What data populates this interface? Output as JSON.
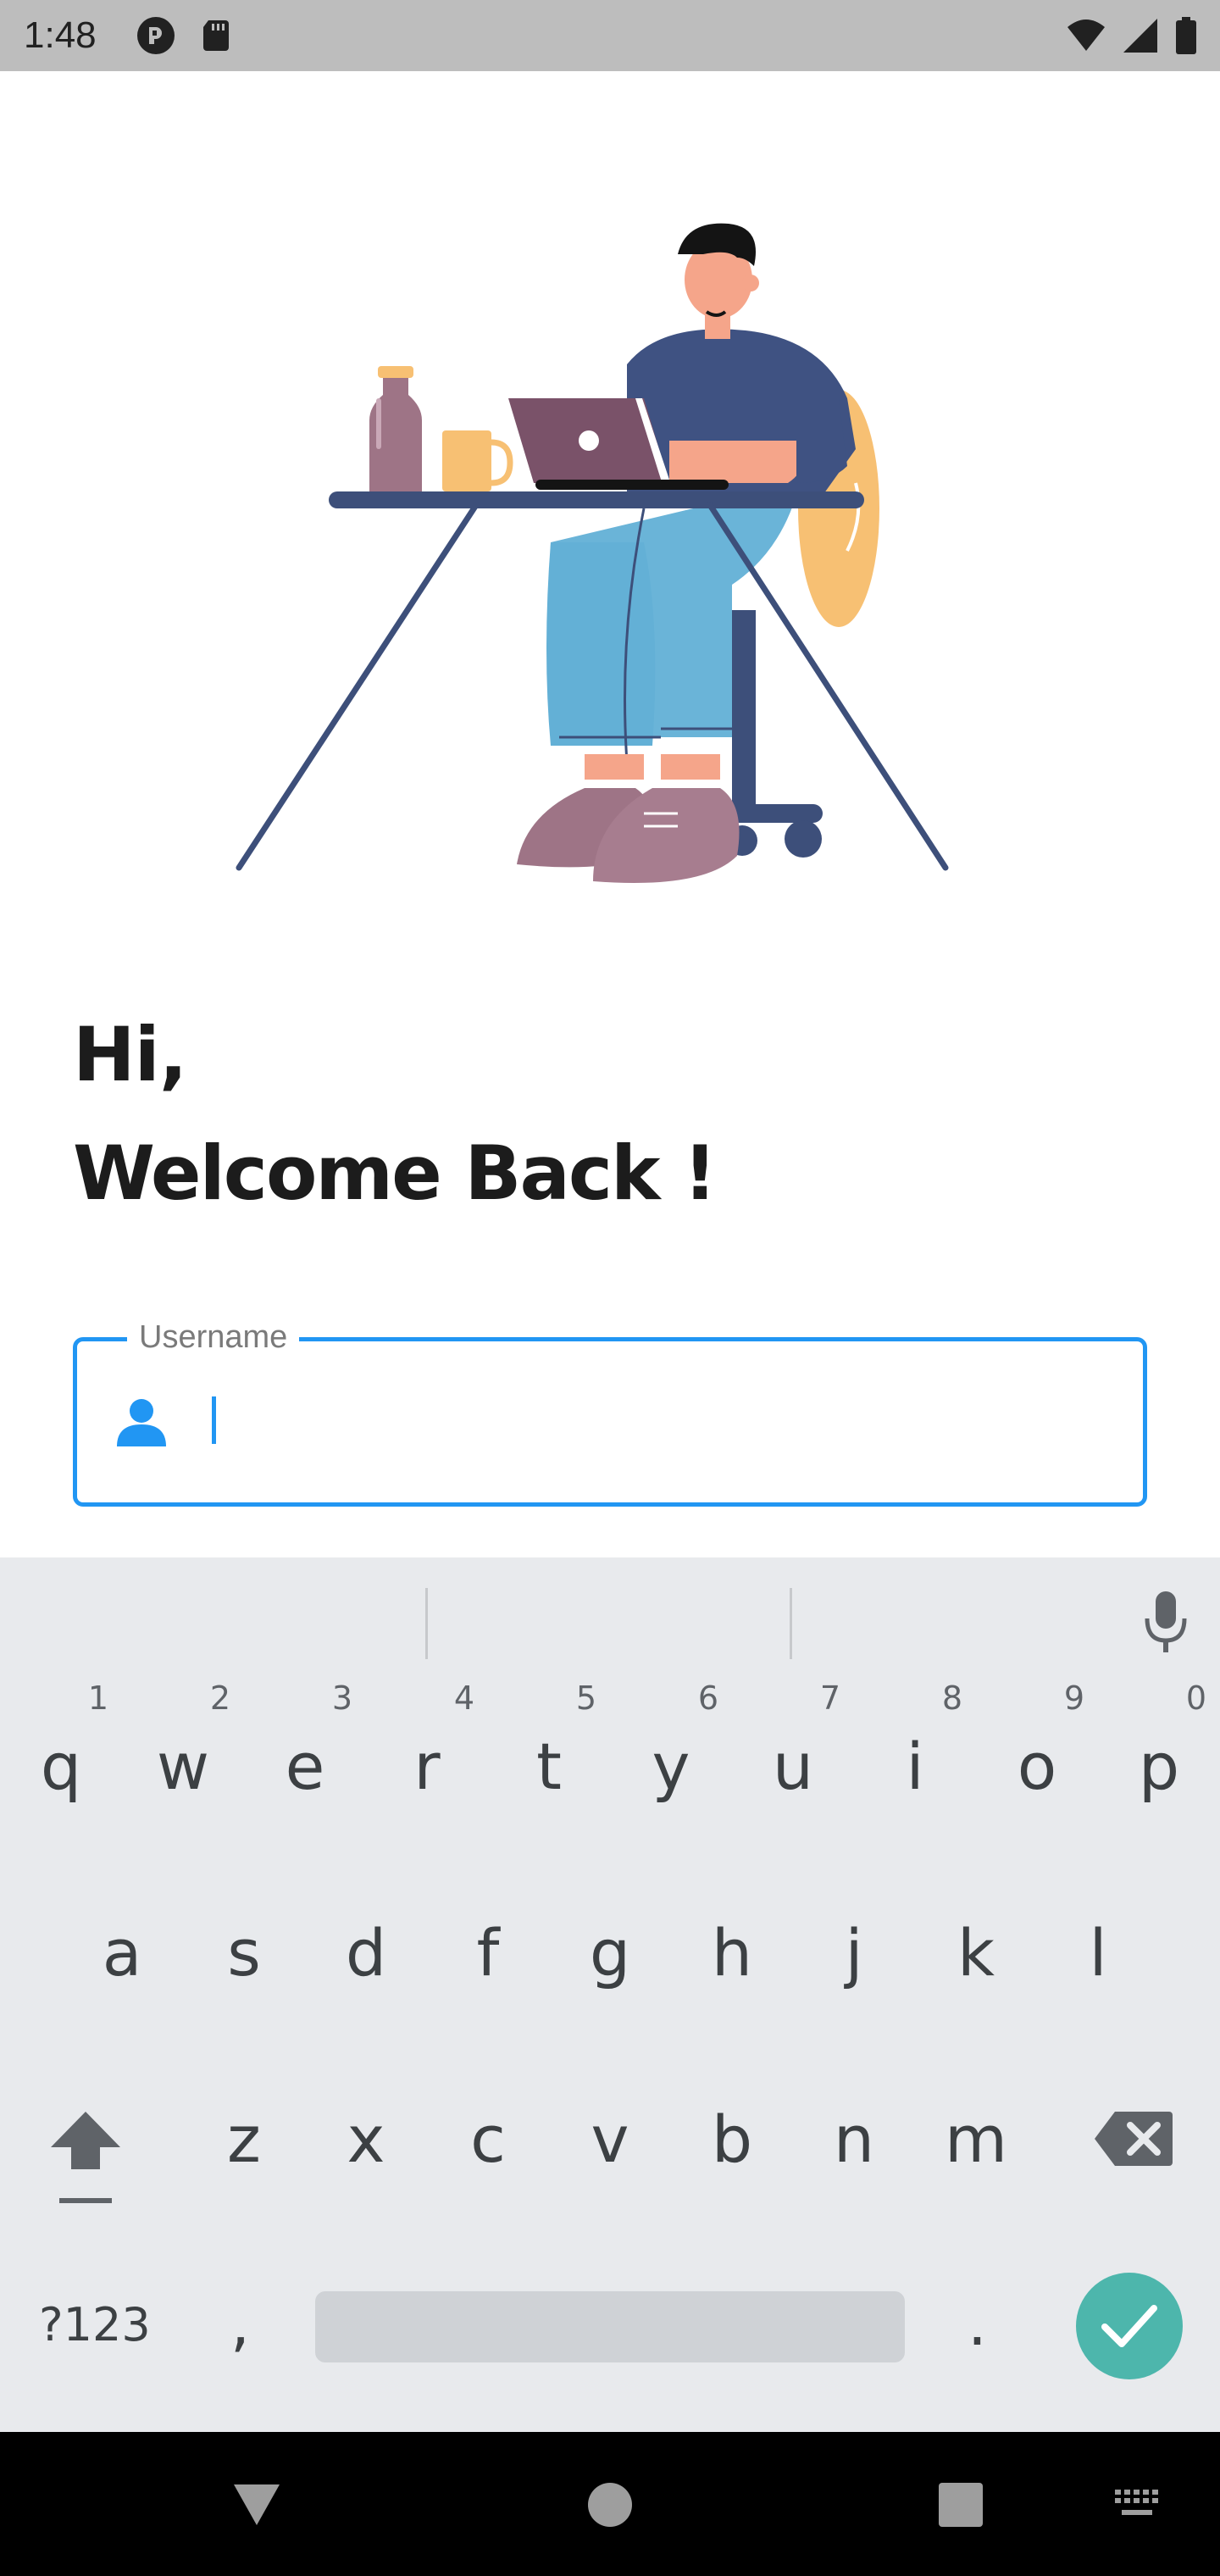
{
  "status_bar": {
    "time": "1:48",
    "left_icons": [
      "privacy-indicator-icon",
      "sd-card-icon"
    ],
    "right_icons": [
      "wifi-icon",
      "cell-signal-icon",
      "battery-icon"
    ]
  },
  "greeting": {
    "line1": "Hi,",
    "line2": "Welcome Back !"
  },
  "username_field": {
    "label": "Username",
    "value": "",
    "icon": "person-icon",
    "accent_color": "#2196f3"
  },
  "keyboard": {
    "row1": [
      {
        "key": "q",
        "hint": "1"
      },
      {
        "key": "w",
        "hint": "2"
      },
      {
        "key": "e",
        "hint": "3"
      },
      {
        "key": "r",
        "hint": "4"
      },
      {
        "key": "t",
        "hint": "5"
      },
      {
        "key": "y",
        "hint": "6"
      },
      {
        "key": "u",
        "hint": "7"
      },
      {
        "key": "i",
        "hint": "8"
      },
      {
        "key": "o",
        "hint": "9"
      },
      {
        "key": "p",
        "hint": "0"
      }
    ],
    "row2": [
      "a",
      "s",
      "d",
      "f",
      "g",
      "h",
      "j",
      "k",
      "l"
    ],
    "row3": [
      "z",
      "x",
      "c",
      "v",
      "b",
      "n",
      "m"
    ],
    "symbols_label": "?123",
    "comma": ",",
    "period": ".",
    "done_color": "#4db6ac"
  },
  "nav_bar": {
    "icons": [
      "back-icon",
      "home-icon",
      "recents-icon",
      "keyboard-switch-icon"
    ]
  }
}
